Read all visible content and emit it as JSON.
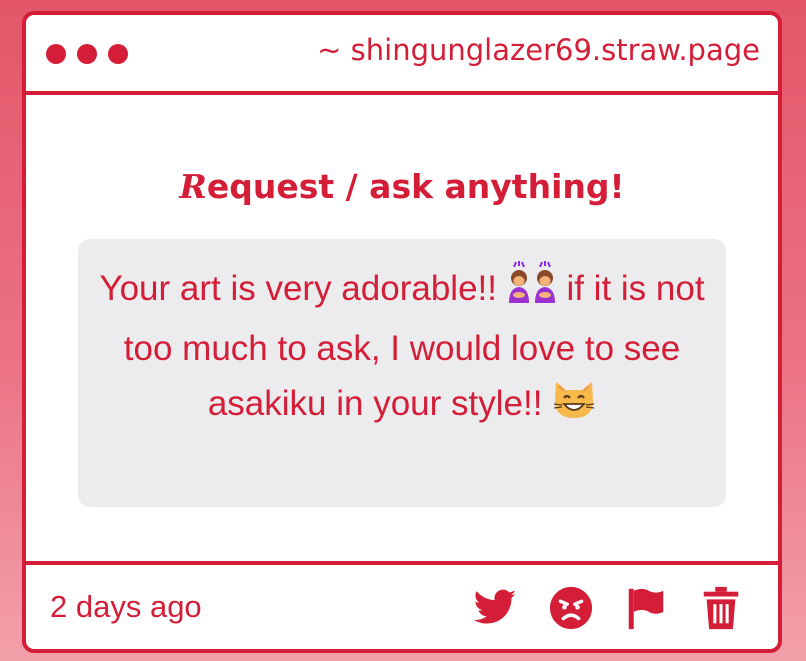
{
  "window": {
    "url": "~ shingunglazer69.straw.page",
    "controls": [
      "red-dot",
      "red-dot",
      "red-dot"
    ]
  },
  "heading": {
    "initial": "R",
    "rest": "equest / ask anything!"
  },
  "message": {
    "part1": "Your art is very adorable!! ",
    "emoji1": "🙇‍♀️",
    "part2": " if it is not too much to ask, I would love to see asakiku in your style!! ",
    "emoji2": "😸"
  },
  "footer": {
    "timestamp": "2 days ago",
    "actions": [
      "twitter-icon",
      "angry-face-icon",
      "flag-icon",
      "trash-icon"
    ]
  },
  "colors": {
    "accent": "#d41e38",
    "background_top": "#e35669",
    "background_bottom": "#f3a0ab",
    "card": "#ffffff",
    "message_bg": "#ecebed"
  }
}
